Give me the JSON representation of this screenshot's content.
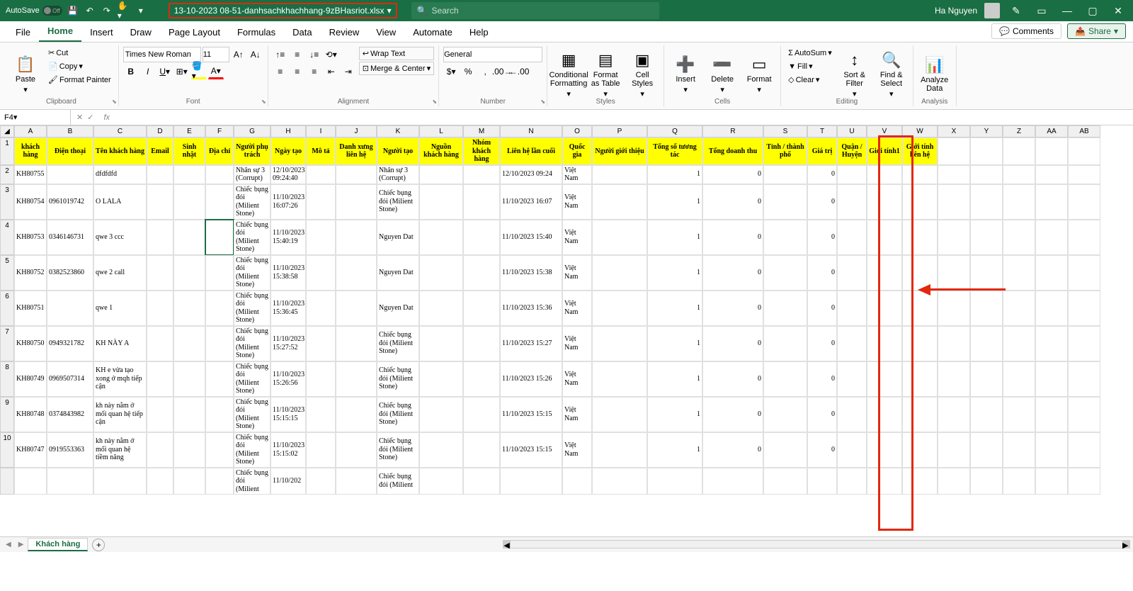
{
  "title_bar": {
    "autosave_label": "AutoSave",
    "filename": "13-10-2023 08-51-danhsachkhachhang-9zBHasriot.xlsx",
    "search_placeholder": "Search",
    "user": "Ha Nguyen"
  },
  "tabs": {
    "file": "File",
    "home": "Home",
    "insert": "Insert",
    "draw": "Draw",
    "page_layout": "Page Layout",
    "formulas": "Formulas",
    "data": "Data",
    "review": "Review",
    "view": "View",
    "automate": "Automate",
    "help": "Help",
    "comments": "Comments",
    "share": "Share"
  },
  "ribbon": {
    "clipboard": {
      "paste": "Paste",
      "cut": "Cut",
      "copy": "Copy",
      "format_painter": "Format Painter",
      "label": "Clipboard"
    },
    "font": {
      "name": "Times New Roman",
      "size": "11",
      "label": "Font"
    },
    "alignment": {
      "wrap": "Wrap Text",
      "merge": "Merge & Center",
      "label": "Alignment"
    },
    "number": {
      "format": "General",
      "label": "Number"
    },
    "styles": {
      "cond": "Conditional Formatting",
      "table": "Format as Table",
      "cell": "Cell Styles",
      "label": "Styles"
    },
    "cells": {
      "insert": "Insert",
      "delete": "Delete",
      "format": "Format",
      "label": "Cells"
    },
    "editing": {
      "autosum": "AutoSum",
      "fill": "Fill",
      "clear": "Clear",
      "sort": "Sort & Filter",
      "find": "Find & Select",
      "label": "Editing"
    },
    "analysis": {
      "analyze": "Analyze Data",
      "label": "Analysis"
    }
  },
  "name_box": "F4",
  "col_letters": [
    "A",
    "B",
    "C",
    "D",
    "E",
    "F",
    "G",
    "H",
    "I",
    "J",
    "K",
    "L",
    "M",
    "N",
    "O",
    "P",
    "Q",
    "R",
    "S",
    "T",
    "U",
    "V",
    "W",
    "X",
    "Y",
    "Z",
    "AA",
    "AB"
  ],
  "headers": [
    "khách hàng",
    "Điện thoại",
    "Tên khách hàng",
    "Email",
    "Sinh nhật",
    "Địa chỉ",
    "Người phụ trách",
    "Ngày tạo",
    "Mô tả",
    "Danh xưng liên hệ",
    "Người tạo",
    "Nguồn khách hàng",
    "Nhóm khách hàng",
    "Liên hệ lần cuối",
    "Quốc gia",
    "Người giới thiệu",
    "Tổng số tương tác",
    "Tổng doanh thu",
    "Tỉnh / thành phố",
    "Giá trị",
    "Quận / Huyện",
    "Giới tính1",
    "Giới tính liên hệ"
  ],
  "rows": [
    {
      "n": "2",
      "A": "KH80755",
      "B": "",
      "C": "dfdfdfd",
      "G": "Nhân sự 3 (Corrupt)",
      "H": "12/10/2023 09:24:40",
      "K": "Nhân sự 3 (Corrupt)",
      "N": "12/10/2023 09:24",
      "O": "Việt Nam",
      "Q": "1",
      "R": "0",
      "T": "0"
    },
    {
      "n": "3",
      "A": "KH80754",
      "B": "0961019742",
      "C": "O LALA",
      "G": "Chiếc bụng đói (Milient Stone)",
      "H": "11/10/2023 16:07:26",
      "K": "Chiếc bụng đói (Milient Stone)",
      "N": "11/10/2023 16:07",
      "O": "Việt Nam",
      "Q": "1",
      "R": "0",
      "T": "0"
    },
    {
      "n": "4",
      "A": "KH80753",
      "B": "0346146731",
      "C": "qwe 3 ccc",
      "G": "Chiếc bụng đói (Milient Stone)",
      "H": "11/10/2023 15:40:19",
      "K": "Nguyen Dat",
      "N": "11/10/2023 15:40",
      "O": "Việt Nam",
      "Q": "1",
      "R": "0",
      "T": "0"
    },
    {
      "n": "5",
      "A": "KH80752",
      "B": "0382523860",
      "C": "qwe 2 call",
      "G": "Chiếc bụng đói (Milient Stone)",
      "H": "11/10/2023 15:38:58",
      "K": "Nguyen Dat",
      "N": "11/10/2023 15:38",
      "O": "Việt Nam",
      "Q": "1",
      "R": "0",
      "T": "0"
    },
    {
      "n": "6",
      "A": "KH80751",
      "B": "",
      "C": "qwe 1",
      "G": "Chiếc bụng đói (Milient Stone)",
      "H": "11/10/2023 15:36:45",
      "K": "Nguyen Dat",
      "N": "11/10/2023 15:36",
      "O": "Việt Nam",
      "Q": "1",
      "R": "0",
      "T": "0"
    },
    {
      "n": "7",
      "A": "KH80750",
      "B": "0949321782",
      "C": "KH NÀY A",
      "G": "Chiếc bụng đói (Milient Stone)",
      "H": "11/10/2023 15:27:52",
      "K": "Chiếc bụng đói (Milient Stone)",
      "N": "11/10/2023 15:27",
      "O": "Việt Nam",
      "Q": "1",
      "R": "0",
      "T": "0"
    },
    {
      "n": "8",
      "A": "KH80749",
      "B": "0969507314",
      "C": "KH e vừa tạo xong ở mqh tiếp cận",
      "G": "Chiếc bụng đói (Milient Stone)",
      "H": "11/10/2023 15:26:56",
      "K": "Chiếc bụng đói (Milient Stone)",
      "N": "11/10/2023 15:26",
      "O": "Việt Nam",
      "Q": "1",
      "R": "0",
      "T": "0"
    },
    {
      "n": "9",
      "A": "KH80748",
      "B": "0374843982",
      "C": "kh này nằm ở mối quan hệ tiếp cận",
      "G": "Chiếc bụng đói (Milient Stone)",
      "H": "11/10/2023 15:15:15",
      "K": "Chiếc bụng đói (Milient Stone)",
      "N": "11/10/2023 15:15",
      "O": "Việt Nam",
      "Q": "1",
      "R": "0",
      "T": "0"
    },
    {
      "n": "10",
      "A": "KH80747",
      "B": "0919553363",
      "C": "kh này nằm ở mối quan hệ tiềm năng",
      "G": "Chiếc bụng đói (Milient Stone)",
      "H": "11/10/2023 15:15:02",
      "K": "Chiếc bụng đói (Milient Stone)",
      "N": "11/10/2023 15:15",
      "O": "Việt Nam",
      "Q": "1",
      "R": "0",
      "T": "0"
    },
    {
      "n": "",
      "A": "",
      "G": "Chiếc bụng đói (Milient",
      "H": "11/10/202",
      "K": "Chiếc bụng đói (Milient"
    }
  ],
  "sheet": {
    "name": "Khách hàng"
  }
}
